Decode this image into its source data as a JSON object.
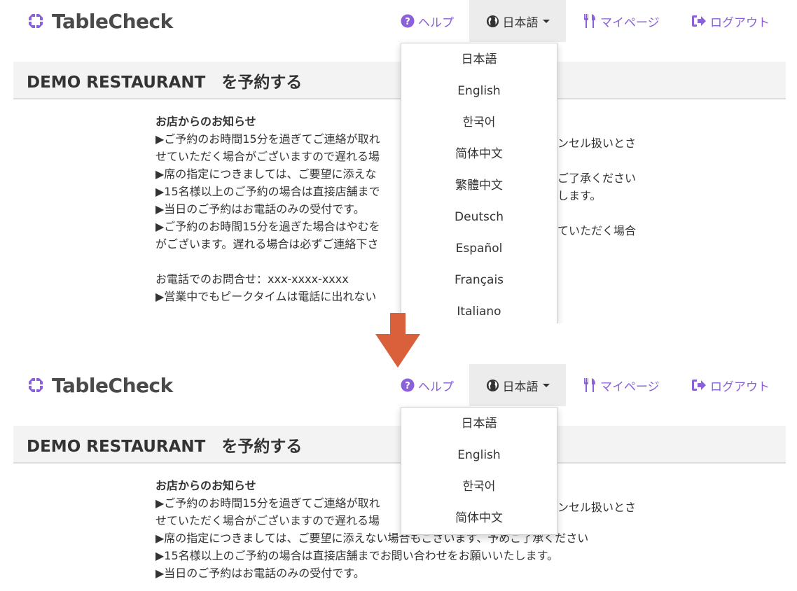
{
  "header": {
    "logo_text": "TableCheck",
    "help_label": "ヘルプ",
    "language_label": "日本語",
    "mypage_label": "マイページ",
    "logout_label": "ログアウト"
  },
  "page": {
    "title": "DEMO RESTAURANT　を予約する"
  },
  "notice": {
    "heading": "お店からのお知らせ",
    "lines": [
      "▶ご予約のお時間15分を過ぎてご連絡が取れ",
      "せていただく場合がございますので遅れる場",
      "▶席の指定につきましては、ご要望に添えな",
      "▶15名様以上のご予約の場合は直接店舗まで",
      "▶当日のご予約はお電話のみの受付です。",
      "▶ご予約のお時間15分を過ぎた場合はやむを",
      "がございます。遅れる場合は必ずご連絡下さ",
      "",
      "お電話でのお問合せ：xxx-xxxx-xxxx",
      "▶営業中でもピークタイムは電話に出れない"
    ],
    "lines_bottom": [
      "▶ご予約のお時間15分を過ぎてご連絡が取れ",
      "せていただく場合がございますので遅れる場",
      "▶席の指定につきましては、ご要望に添えない場合もございます、予めご了承ください",
      "▶15名様以上のご予約の場合は直接店舗までお問い合わせをお願いいたします。",
      "▶当日のご予約はお電話のみの受付です。"
    ],
    "fragments_right": [
      "ンセル扱いとさ",
      "ご了承ください",
      "します。",
      "ていただく場合"
    ]
  },
  "language_menu": {
    "options": [
      "日本語",
      "English",
      "한국어",
      "简体中文",
      "繁體中文",
      "Deutsch",
      "Español",
      "Français",
      "Italiano"
    ]
  },
  "colors": {
    "brand": "#8a60db",
    "arrow": "#d9603b"
  }
}
